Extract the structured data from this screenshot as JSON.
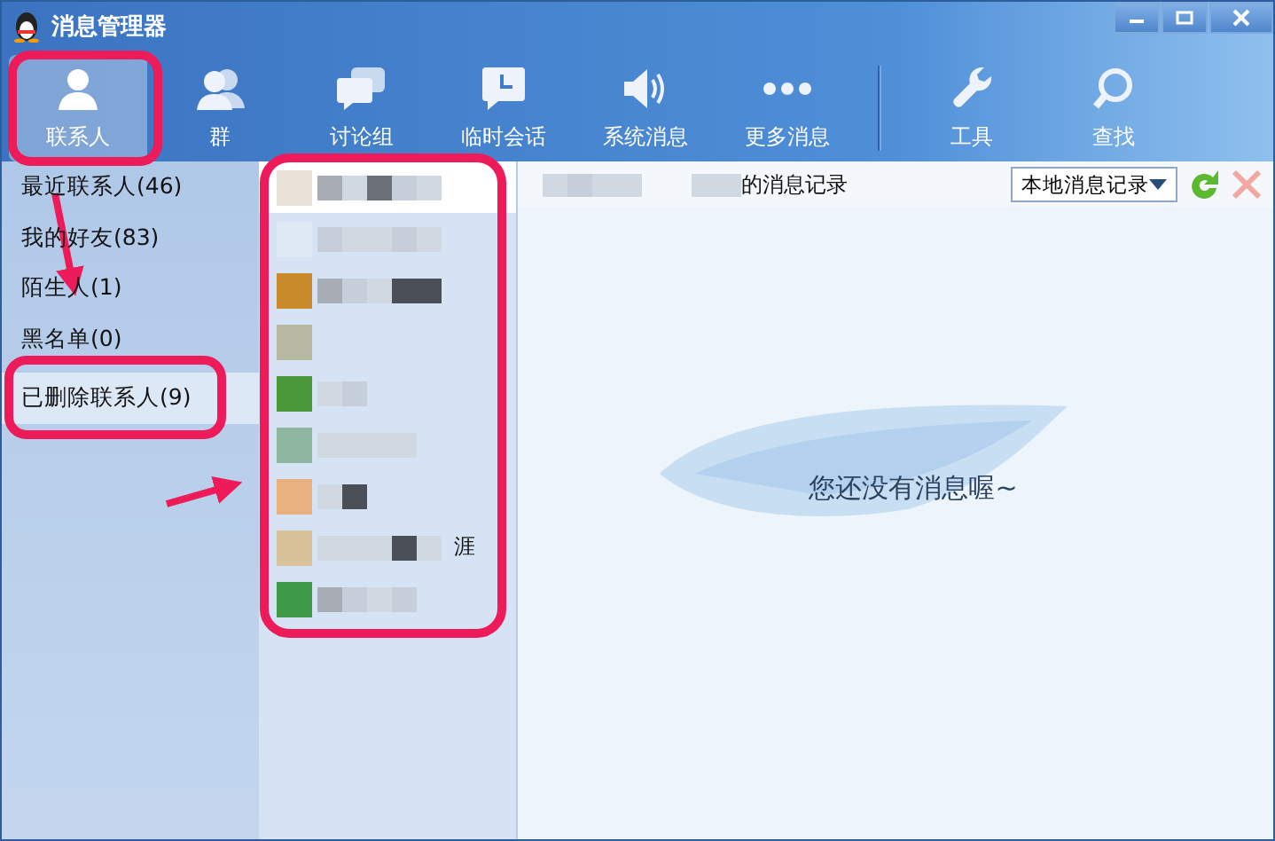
{
  "window": {
    "title": "消息管理器"
  },
  "toolbar": [
    {
      "label": "联系人",
      "selected": true
    },
    {
      "label": "群",
      "selected": false
    },
    {
      "label": "讨论组",
      "selected": false
    },
    {
      "label": "临时会话",
      "selected": false
    },
    {
      "label": "系统消息",
      "selected": false
    },
    {
      "label": "更多消息",
      "selected": false
    },
    {
      "label": "工具",
      "selected": false
    },
    {
      "label": "查找",
      "selected": false
    }
  ],
  "categories": [
    {
      "label": "最近联系人(46)",
      "selected": false
    },
    {
      "label": "我的好友(83)",
      "selected": false
    },
    {
      "label": "陌生人(1)",
      "selected": false
    },
    {
      "label": "黑名单(0)",
      "selected": false
    },
    {
      "label": "已删除联系人(9)",
      "selected": true
    }
  ],
  "contacts": [
    {
      "selected": true
    },
    {
      "selected": false
    },
    {
      "selected": false
    },
    {
      "selected": false
    },
    {
      "selected": false
    },
    {
      "selected": false
    },
    {
      "selected": false
    },
    {
      "selected": false,
      "note": "涯"
    },
    {
      "selected": false
    }
  ],
  "header": {
    "title_suffix": "的消息记录",
    "source": "本地消息记录"
  },
  "empty_message": "您还没有消息喔~"
}
